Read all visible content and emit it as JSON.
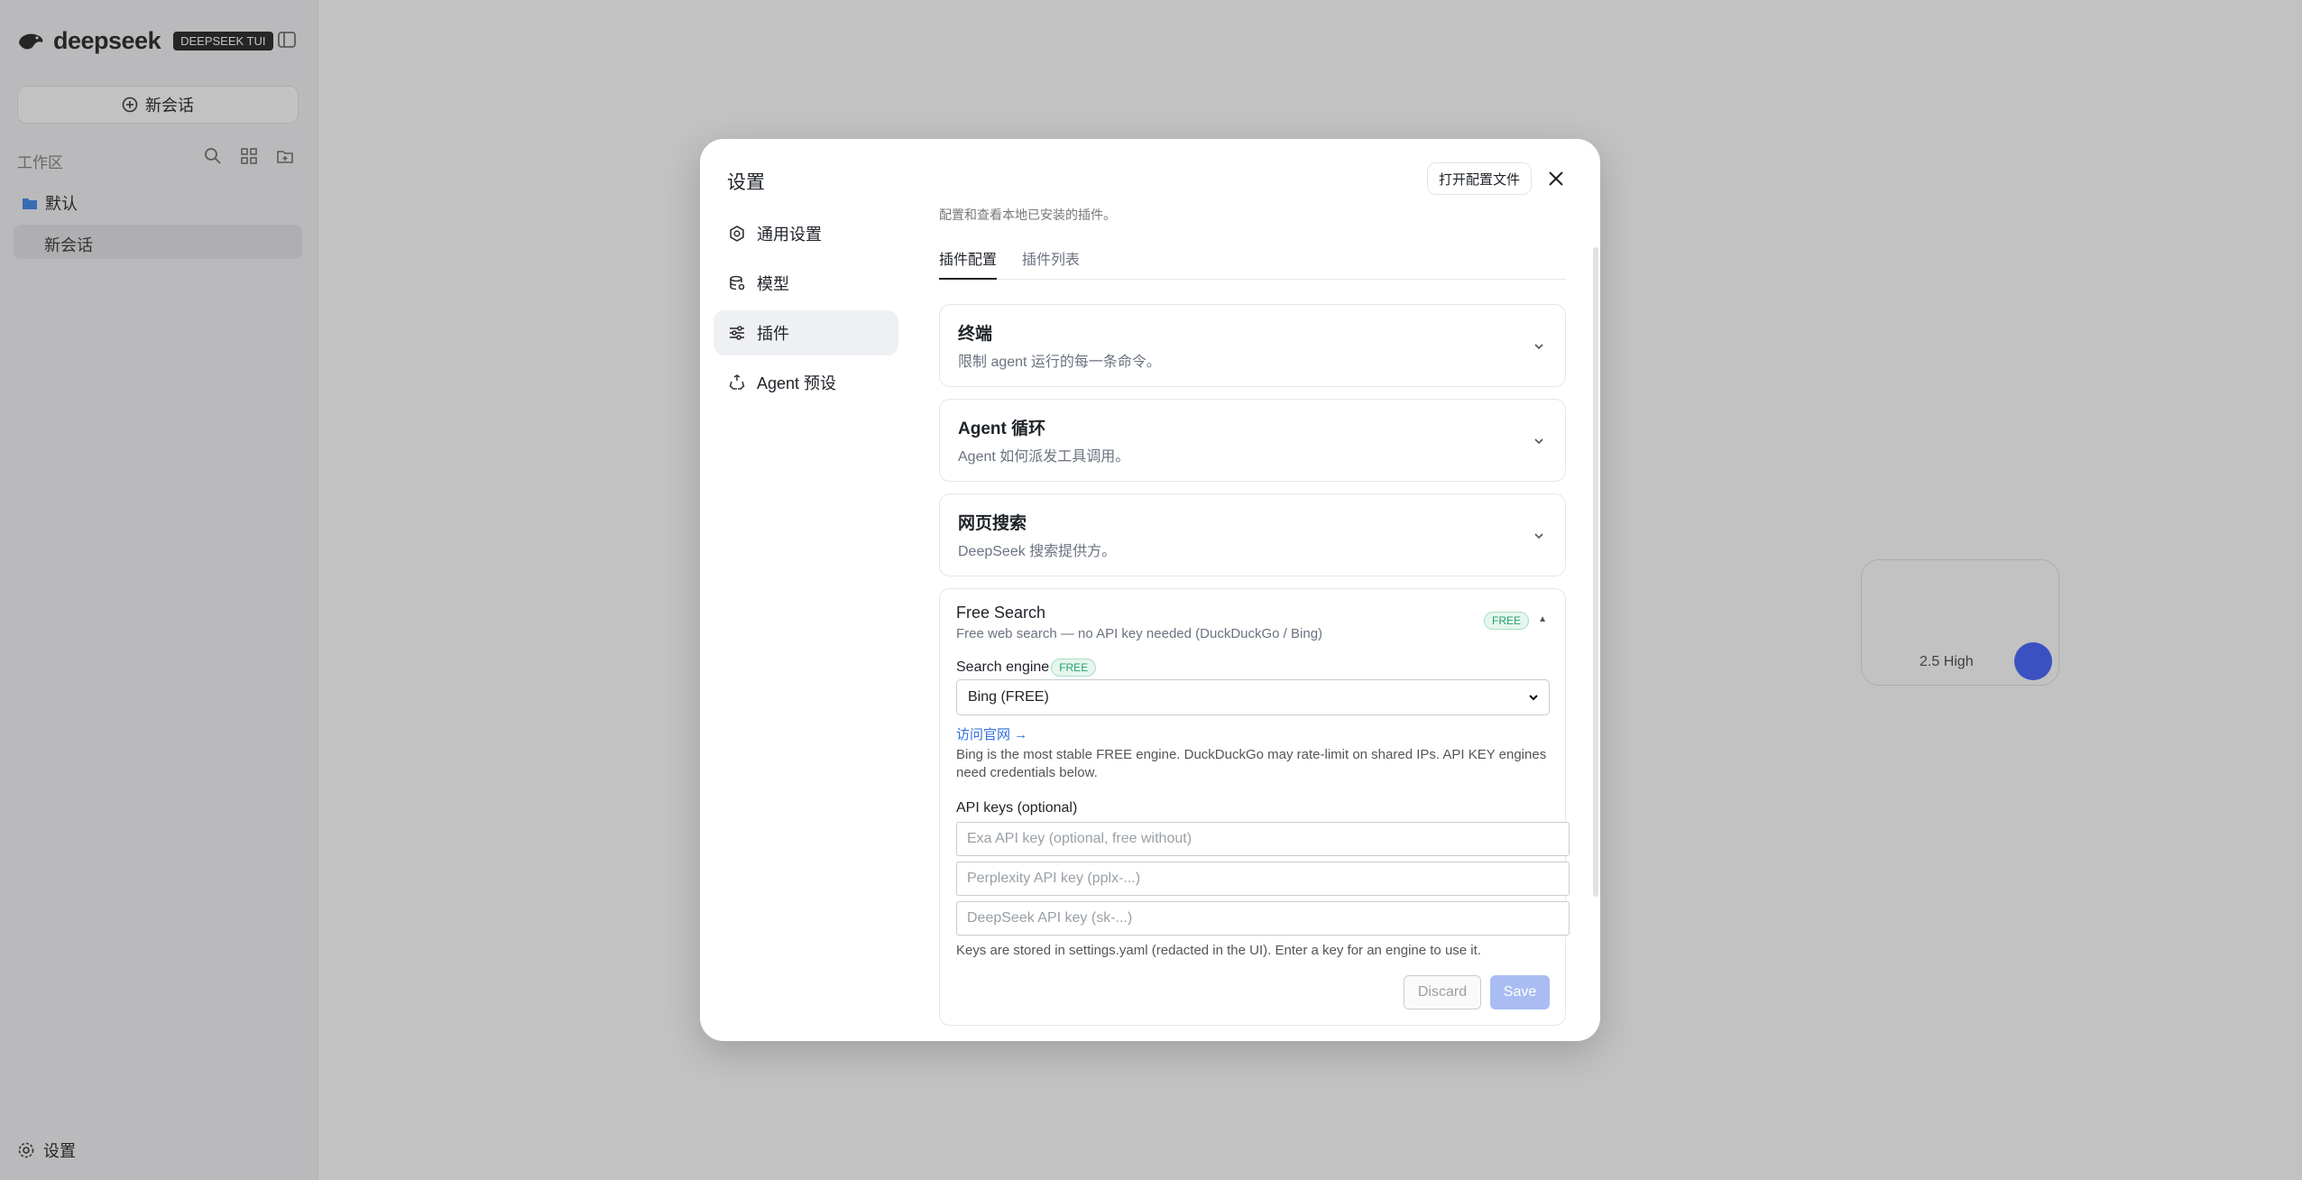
{
  "app": {
    "brand": "deepseek",
    "brand_badge": "DEEPSEEK TUI",
    "new_chat": "新会话",
    "workspace_label": "工作区",
    "folder": "默认",
    "session": "新会话",
    "settings": "设置",
    "composer_model": "2.5 High"
  },
  "modal": {
    "title": "设置",
    "open_config": "打开配置文件",
    "nav": [
      {
        "label": "通用设置",
        "icon": "gear-icon"
      },
      {
        "label": "模型",
        "icon": "database-icon"
      },
      {
        "label": "插件",
        "icon": "sliders-icon"
      },
      {
        "label": "Agent 预设",
        "icon": "recycle-icon"
      }
    ],
    "active_nav": "插件",
    "cut_text": "配置和查看本地已安装的插件。",
    "tabs": [
      "插件配置",
      "插件列表"
    ],
    "active_tab": "插件配置",
    "cards": [
      {
        "title": "终端",
        "subtitle": "限制 agent 运行的每一条命令。"
      },
      {
        "title": "Agent 循环",
        "subtitle": "Agent 如何派发工具调用。"
      },
      {
        "title": "网页搜索",
        "subtitle": "DeepSeek 搜索提供方。"
      }
    ],
    "free_search": {
      "title": "Free Search",
      "subtitle": "Free web search — no API key needed (DuckDuckGo / Bing)",
      "badge": "FREE",
      "caret": "▲",
      "engine_label": "Search engine",
      "engine_badge": "FREE",
      "engine_value": "Bing (FREE)",
      "visit_link": "访问官网 →",
      "engine_help": "Bing is the most stable FREE engine. DuckDuckGo may rate-limit on shared IPs. API KEY engines need credentials below.",
      "keys_label": "API keys (optional)",
      "key_placeholders": [
        "Exa API key (optional, free without)",
        "Perplexity API key (pplx-...)",
        "DeepSeek API key (sk-...)"
      ],
      "keys_help": "Keys are stored in settings.yaml (redacted in the UI). Enter a key for an engine to use it.",
      "discard": "Discard",
      "save": "Save"
    }
  },
  "colors": {
    "accent": "#4d6bfe",
    "link": "#2f6fde",
    "save_disabled": "#a9bdf2",
    "free_badge": "#22a06b"
  }
}
